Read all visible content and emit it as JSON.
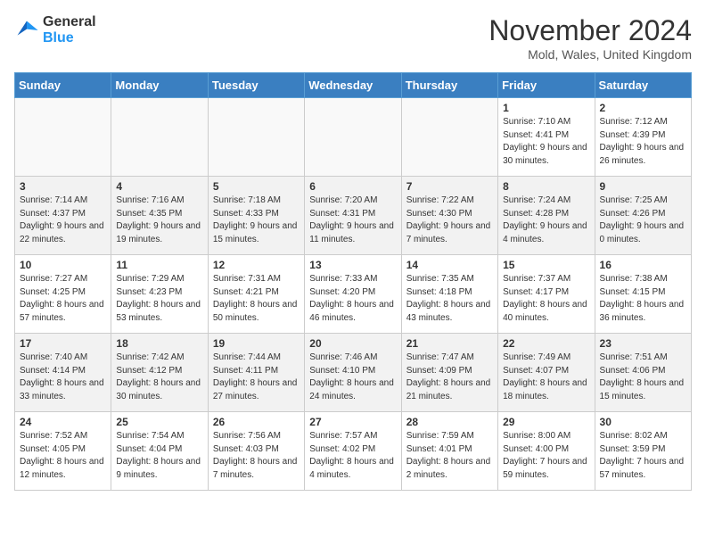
{
  "logo": {
    "line1": "General",
    "line2": "Blue"
  },
  "title": "November 2024",
  "location": "Mold, Wales, United Kingdom",
  "weekdays": [
    "Sunday",
    "Monday",
    "Tuesday",
    "Wednesday",
    "Thursday",
    "Friday",
    "Saturday"
  ],
  "weeks": [
    [
      {
        "day": "",
        "info": ""
      },
      {
        "day": "",
        "info": ""
      },
      {
        "day": "",
        "info": ""
      },
      {
        "day": "",
        "info": ""
      },
      {
        "day": "",
        "info": ""
      },
      {
        "day": "1",
        "info": "Sunrise: 7:10 AM\nSunset: 4:41 PM\nDaylight: 9 hours and 30 minutes."
      },
      {
        "day": "2",
        "info": "Sunrise: 7:12 AM\nSunset: 4:39 PM\nDaylight: 9 hours and 26 minutes."
      }
    ],
    [
      {
        "day": "3",
        "info": "Sunrise: 7:14 AM\nSunset: 4:37 PM\nDaylight: 9 hours and 22 minutes."
      },
      {
        "day": "4",
        "info": "Sunrise: 7:16 AM\nSunset: 4:35 PM\nDaylight: 9 hours and 19 minutes."
      },
      {
        "day": "5",
        "info": "Sunrise: 7:18 AM\nSunset: 4:33 PM\nDaylight: 9 hours and 15 minutes."
      },
      {
        "day": "6",
        "info": "Sunrise: 7:20 AM\nSunset: 4:31 PM\nDaylight: 9 hours and 11 minutes."
      },
      {
        "day": "7",
        "info": "Sunrise: 7:22 AM\nSunset: 4:30 PM\nDaylight: 9 hours and 7 minutes."
      },
      {
        "day": "8",
        "info": "Sunrise: 7:24 AM\nSunset: 4:28 PM\nDaylight: 9 hours and 4 minutes."
      },
      {
        "day": "9",
        "info": "Sunrise: 7:25 AM\nSunset: 4:26 PM\nDaylight: 9 hours and 0 minutes."
      }
    ],
    [
      {
        "day": "10",
        "info": "Sunrise: 7:27 AM\nSunset: 4:25 PM\nDaylight: 8 hours and 57 minutes."
      },
      {
        "day": "11",
        "info": "Sunrise: 7:29 AM\nSunset: 4:23 PM\nDaylight: 8 hours and 53 minutes."
      },
      {
        "day": "12",
        "info": "Sunrise: 7:31 AM\nSunset: 4:21 PM\nDaylight: 8 hours and 50 minutes."
      },
      {
        "day": "13",
        "info": "Sunrise: 7:33 AM\nSunset: 4:20 PM\nDaylight: 8 hours and 46 minutes."
      },
      {
        "day": "14",
        "info": "Sunrise: 7:35 AM\nSunset: 4:18 PM\nDaylight: 8 hours and 43 minutes."
      },
      {
        "day": "15",
        "info": "Sunrise: 7:37 AM\nSunset: 4:17 PM\nDaylight: 8 hours and 40 minutes."
      },
      {
        "day": "16",
        "info": "Sunrise: 7:38 AM\nSunset: 4:15 PM\nDaylight: 8 hours and 36 minutes."
      }
    ],
    [
      {
        "day": "17",
        "info": "Sunrise: 7:40 AM\nSunset: 4:14 PM\nDaylight: 8 hours and 33 minutes."
      },
      {
        "day": "18",
        "info": "Sunrise: 7:42 AM\nSunset: 4:12 PM\nDaylight: 8 hours and 30 minutes."
      },
      {
        "day": "19",
        "info": "Sunrise: 7:44 AM\nSunset: 4:11 PM\nDaylight: 8 hours and 27 minutes."
      },
      {
        "day": "20",
        "info": "Sunrise: 7:46 AM\nSunset: 4:10 PM\nDaylight: 8 hours and 24 minutes."
      },
      {
        "day": "21",
        "info": "Sunrise: 7:47 AM\nSunset: 4:09 PM\nDaylight: 8 hours and 21 minutes."
      },
      {
        "day": "22",
        "info": "Sunrise: 7:49 AM\nSunset: 4:07 PM\nDaylight: 8 hours and 18 minutes."
      },
      {
        "day": "23",
        "info": "Sunrise: 7:51 AM\nSunset: 4:06 PM\nDaylight: 8 hours and 15 minutes."
      }
    ],
    [
      {
        "day": "24",
        "info": "Sunrise: 7:52 AM\nSunset: 4:05 PM\nDaylight: 8 hours and 12 minutes."
      },
      {
        "day": "25",
        "info": "Sunrise: 7:54 AM\nSunset: 4:04 PM\nDaylight: 8 hours and 9 minutes."
      },
      {
        "day": "26",
        "info": "Sunrise: 7:56 AM\nSunset: 4:03 PM\nDaylight: 8 hours and 7 minutes."
      },
      {
        "day": "27",
        "info": "Sunrise: 7:57 AM\nSunset: 4:02 PM\nDaylight: 8 hours and 4 minutes."
      },
      {
        "day": "28",
        "info": "Sunrise: 7:59 AM\nSunset: 4:01 PM\nDaylight: 8 hours and 2 minutes."
      },
      {
        "day": "29",
        "info": "Sunrise: 8:00 AM\nSunset: 4:00 PM\nDaylight: 7 hours and 59 minutes."
      },
      {
        "day": "30",
        "info": "Sunrise: 8:02 AM\nSunset: 3:59 PM\nDaylight: 7 hours and 57 minutes."
      }
    ]
  ]
}
